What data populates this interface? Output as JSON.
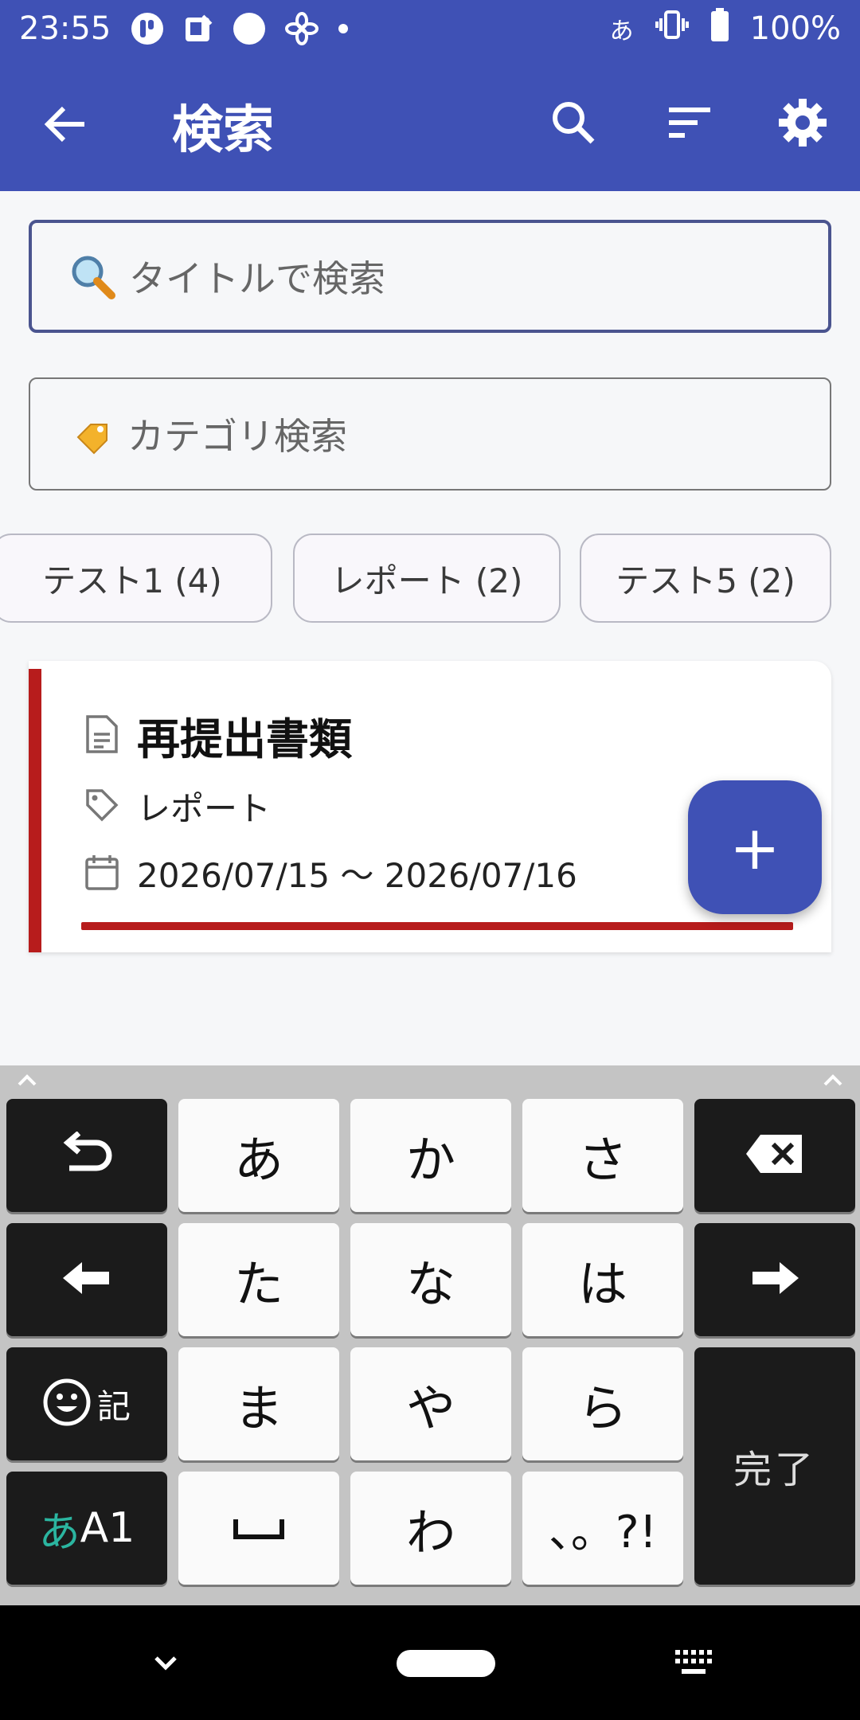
{
  "status_bar": {
    "time": "23:55",
    "ime_indicator": "あ",
    "battery": "100%",
    "icons": [
      "app-icon",
      "notification-icon",
      "circle-icon",
      "pinwheel-icon",
      "dot-icon",
      "vibrate-icon",
      "battery-icon"
    ]
  },
  "app_bar": {
    "title": "検索",
    "back_icon": "arrow-back-icon",
    "actions": [
      "search-icon",
      "sort-icon",
      "gear-icon"
    ],
    "color": "#3f51b5"
  },
  "search": {
    "title_placeholder": "タイトルで検索",
    "title_icon": "magnifier-emoji-icon",
    "category_placeholder": "カテゴリ検索",
    "category_icon": "tag-emoji-icon"
  },
  "chips": [
    {
      "label": "テスト1 (4)"
    },
    {
      "label": "レポート (2)"
    },
    {
      "label": "テスト5 (2)"
    }
  ],
  "result_card": {
    "title": "再提出書類",
    "category": "レポート",
    "date_range": "2026/07/15 〜 2026/07/16",
    "accent": "#b71c1c",
    "icons": [
      "document-icon",
      "tag-icon",
      "calendar-icon"
    ]
  },
  "fab": {
    "label": "+"
  },
  "keyboard": {
    "keys": {
      "a": "あ",
      "ka": "か",
      "sa": "さ",
      "ta": "た",
      "na": "な",
      "ha": "は",
      "ma": "ま",
      "ya": "や",
      "ra": "ら",
      "space": "␣",
      "wa": "わ",
      "punct": "、。?!",
      "kigou": "記",
      "mode_a": "あ",
      "mode_rest": "A1",
      "done": "完了"
    },
    "icons": [
      "undo-icon",
      "backspace-icon",
      "arrow-left-icon",
      "arrow-right-icon",
      "emoji-icon",
      "chevron-up-icon"
    ]
  },
  "nav_bar": {
    "icons": [
      "chevron-down-icon",
      "home-pill-icon",
      "keyboard-icon"
    ]
  }
}
